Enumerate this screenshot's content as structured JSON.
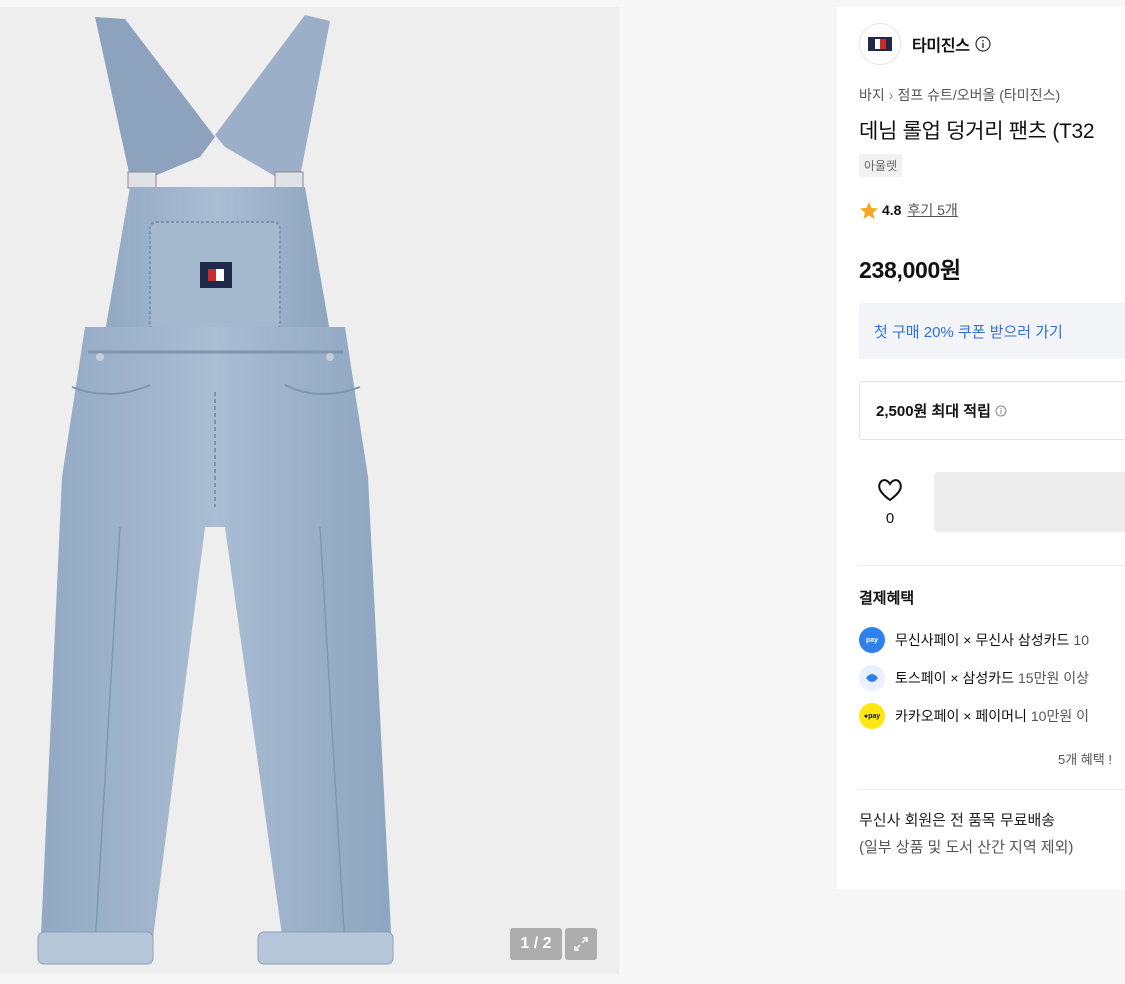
{
  "gallery": {
    "counter": "1 / 2"
  },
  "brand": {
    "name": "타미진스"
  },
  "breadcrumb": {
    "category": "바지",
    "subcategory": "점프 슈트/오버올 (타미진스)"
  },
  "product": {
    "title": "데님 롤업 덩거리 팬츠 (T32",
    "tag": "아울렛",
    "rating": "4.8",
    "reviews": "후기 5개",
    "price": "238,000원"
  },
  "coupon": {
    "label": "첫 구매 20% 쿠폰 받으러 가기"
  },
  "points": {
    "label": "2,500원 최대 적립"
  },
  "like": {
    "count": "0"
  },
  "benefits": {
    "title": "결제혜택",
    "items": [
      {
        "name": "무신사페이 × 무신사 삼성카드",
        "desc": "10",
        "icon": "musinsa-pay-icon",
        "color": "#2f80ed"
      },
      {
        "name": "토스페이 × 삼성카드",
        "desc": "15만원 이상",
        "icon": "toss-pay-icon",
        "color": "#e8f1fd"
      },
      {
        "name": "카카오페이 × 페이머니",
        "desc": "10만원 이",
        "icon": "kakao-pay-icon",
        "color": "#ffe812"
      }
    ],
    "more": "5개 혜택 !"
  },
  "shipping": {
    "line1": "무신사 회원은 전 품목 무료배송",
    "line2": "(일부 상품 및 도서 산간 지역 제외)"
  }
}
